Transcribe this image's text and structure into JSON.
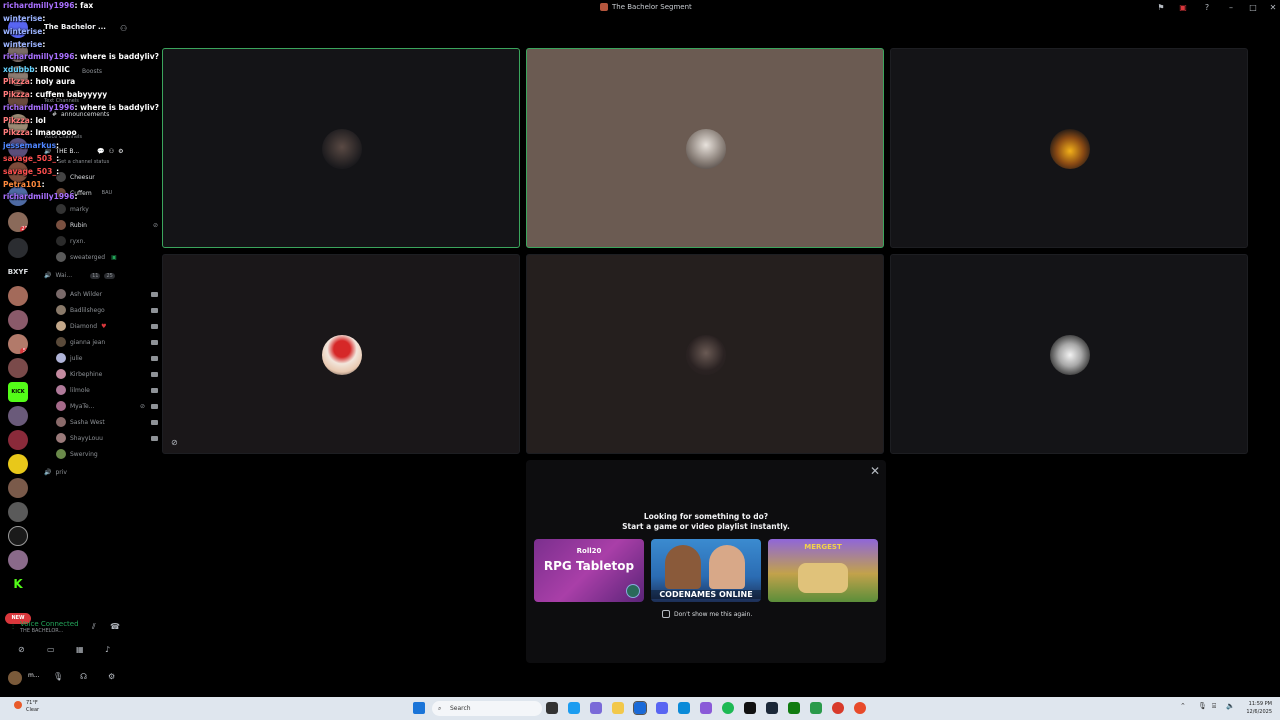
{
  "window": {
    "title": "The Bachelor Segment"
  },
  "server_header": {
    "name": "The Bachelor ..."
  },
  "chat_overlay": [
    {
      "user": "richardmilly1996",
      "msg": "fax",
      "color": "#a970ff"
    },
    {
      "user": "winterise",
      "msg": "",
      "color": "#9bb3ff"
    },
    {
      "user": "winterise",
      "msg": "",
      "color": "#9bb3ff"
    },
    {
      "user": "winterise",
      "msg": "",
      "color": "#9bb3ff"
    },
    {
      "user": "richardmilly1996",
      "msg": "where is baddyliv?",
      "color": "#a970ff"
    },
    {
      "user": "xdubbb",
      "msg": "IRONIC",
      "color": "#66d4ff"
    },
    {
      "user": "Pikzza",
      "msg": "holy aura",
      "color": "#ff7a7a"
    },
    {
      "user": "Pikzza",
      "msg": "cuffem babyyyyy",
      "color": "#ff7a7a"
    },
    {
      "user": "richardmilly1996",
      "msg": "where is baddyliv?",
      "color": "#a970ff"
    },
    {
      "user": "Pikzza",
      "msg": "lol",
      "color": "#ff7a7a"
    },
    {
      "user": "Pikzza",
      "msg": "lmaooooo",
      "color": "#ff7a7a"
    },
    {
      "user": "jessemarkus",
      "msg": "",
      "color": "#4f86ff"
    },
    {
      "user": "savage_503_",
      "msg": "",
      "color": "#ff4f4f"
    },
    {
      "user": "savage_503_",
      "msg": "",
      "color": "#ff4f4f"
    },
    {
      "user": "Petra101",
      "msg": "",
      "color": "#ff8a3d"
    },
    {
      "user": "richardmilly1996",
      "msg": "",
      "color": "#a970ff"
    }
  ],
  "sidebar": {
    "boosts_label": "Boosts",
    "text_channels_label": "Text Channels",
    "announcements": "announcements",
    "voice_channels_label": "Voice Channels",
    "voice_channel_name": "THE B...",
    "set_status": "Set a channel status",
    "voice_members": [
      "Cheesur",
      "Cuffem",
      "marky",
      "Rubin",
      "ryxn.",
      "sweaterged"
    ],
    "cuffem_tag": "BAU",
    "waiting_channel": "Wai...",
    "waiting_counts": [
      "11",
      "25"
    ],
    "waiting_members": [
      "Ash Wilder",
      "Badlilshego",
      "Diamond",
      "gianna jean",
      "julie",
      "Kirbephine",
      "lilmole",
      "MyaTe...",
      "Sasha West",
      "ShayyLouu",
      "Swerving"
    ],
    "priv_channel": "priv",
    "server_label_bxyf": "BXYF",
    "server_label_kick": "KICK",
    "new_pill": "NEW",
    "server_badges": [
      "23",
      "5"
    ]
  },
  "voice_panel": {
    "status": "Voice Connected",
    "channel": "THE BACHELOR..."
  },
  "user_panel": {
    "name": "m..."
  },
  "video_tiles": [
    {
      "name": "tile-1",
      "speaking": true
    },
    {
      "name": "tile-2",
      "speaking": true
    },
    {
      "name": "tile-3",
      "speaking": false
    },
    {
      "name": "tile-4",
      "speaking": false,
      "muted": true
    },
    {
      "name": "tile-5",
      "speaking": false
    },
    {
      "name": "tile-6",
      "speaking": false
    }
  ],
  "activity": {
    "heading": "Looking for something to do?",
    "subheading": "Start a game or video playlist instantly.",
    "cards": [
      {
        "brand": "Roll20",
        "title": "RPG Tabletop"
      },
      {
        "title": "CODENAMES ONLINE"
      },
      {
        "title": "MERGEST"
      }
    ],
    "dont_show": "Don't show me this again."
  },
  "taskbar": {
    "weather_temp": "71°F",
    "weather_desc": "Clear",
    "search_placeholder": "Search",
    "time": "11:59 PM",
    "date": "12/6/2025"
  }
}
